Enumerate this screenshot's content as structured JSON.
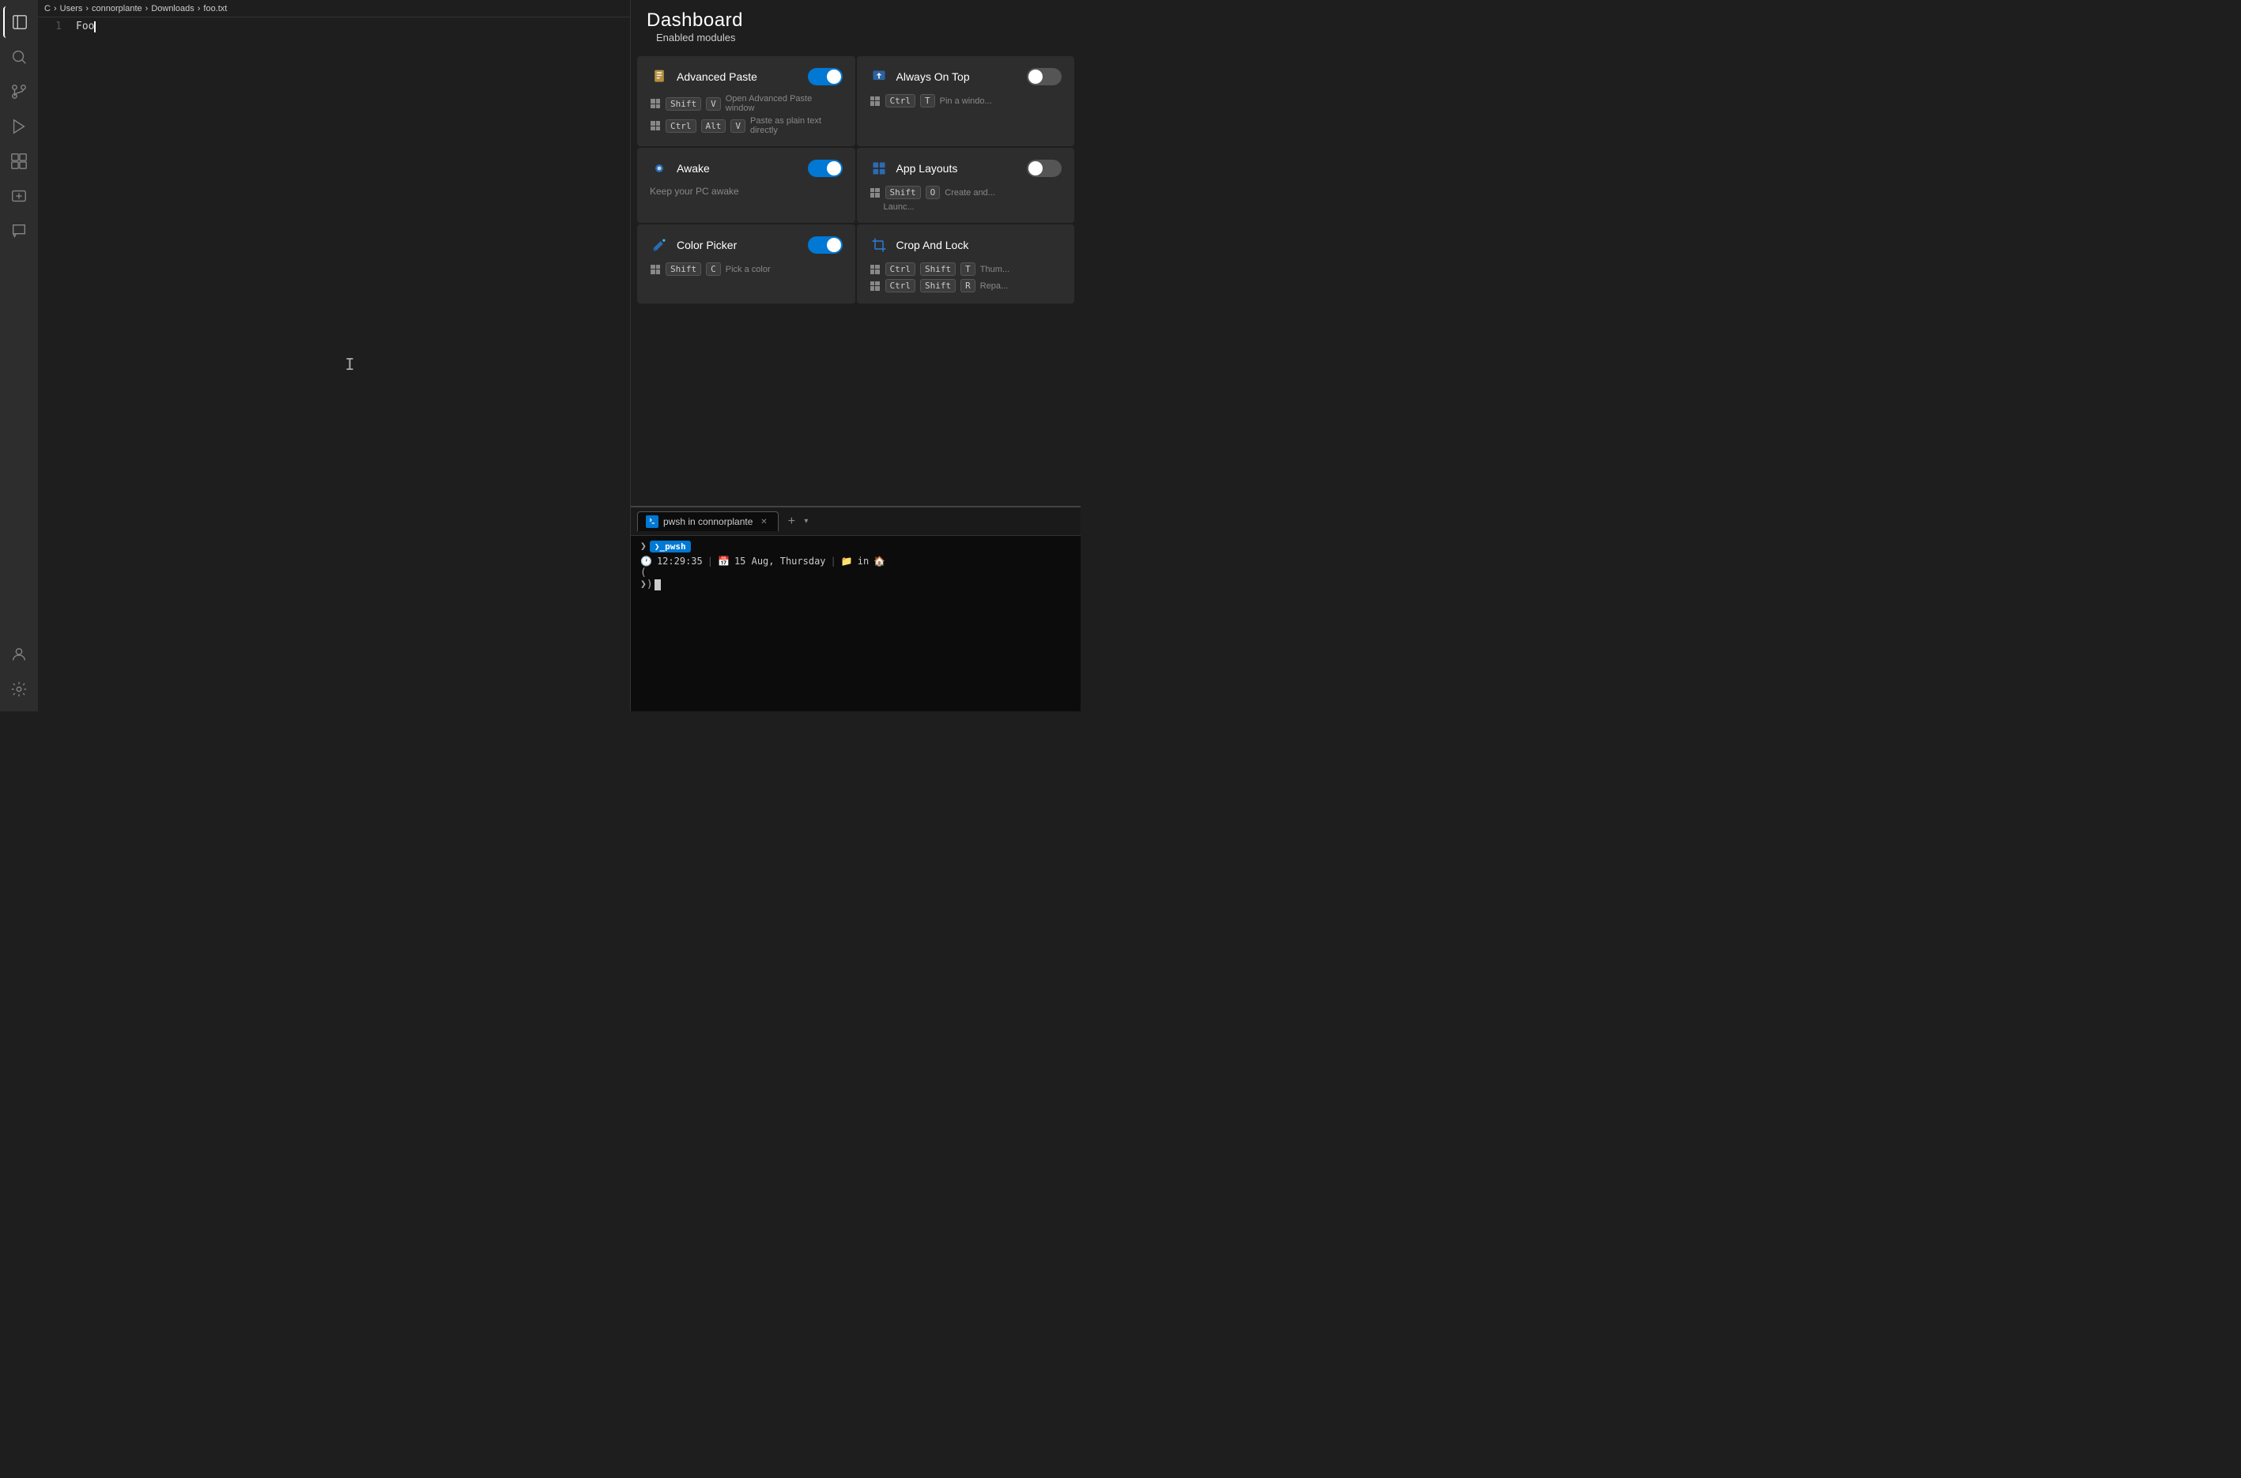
{
  "activityBar": {
    "icons": [
      {
        "name": "explorer-icon",
        "symbol": "☰",
        "active": true
      },
      {
        "name": "search-icon",
        "symbol": "🔍"
      },
      {
        "name": "source-control-icon",
        "symbol": "⑂"
      },
      {
        "name": "run-debug-icon",
        "symbol": "▶"
      },
      {
        "name": "extensions-icon",
        "symbol": "⊞"
      },
      {
        "name": "remote-icon",
        "symbol": "⬡"
      },
      {
        "name": "chat-icon",
        "symbol": "💬"
      }
    ],
    "bottomIcons": [
      {
        "name": "account-icon",
        "symbol": "👤"
      },
      {
        "name": "settings-icon",
        "symbol": "⚙"
      }
    ]
  },
  "editor": {
    "breadcrumb": "C > Users > connorplante > Downloads > foo.txt",
    "breadcrumbParts": [
      "C",
      "Users",
      "connorplante",
      "Downloads",
      "foo.txt"
    ],
    "lineNumber": "1",
    "lineContent": "Foo",
    "cursor": true
  },
  "dashboard": {
    "title": "Dashboard",
    "enabledLabel": "Enabled modules",
    "modules": [
      {
        "id": "advanced-paste",
        "name": "Advanced Paste",
        "icon": "📋",
        "iconBg": "#d4a843",
        "enabled": true,
        "shortcuts": [
          {
            "keys": [
              "Shift",
              "V"
            ],
            "desc": "Open Advanced Paste window"
          },
          {
            "keys": [
              "Ctrl",
              "Alt",
              "V"
            ],
            "desc": "Paste as plain text directly"
          }
        ]
      },
      {
        "id": "always-on-top",
        "name": "Always On Top",
        "icon": "📌",
        "iconBg": "#2b7ad4",
        "enabled": false,
        "shortcuts": [
          {
            "keys": [
              "Ctrl",
              "T"
            ],
            "desc": "Pin a windo..."
          }
        ]
      },
      {
        "id": "awake",
        "name": "Awake",
        "icon": "☕",
        "iconBg": "#2b7ad4",
        "enabled": true,
        "desc": "Keep your PC awake",
        "shortcuts": []
      },
      {
        "id": "app-layouts",
        "name": "App Layouts",
        "icon": "⊞",
        "iconBg": "#2b7ad4",
        "enabled": false,
        "shortcuts": [
          {
            "keys": [
              "Shift",
              "O"
            ],
            "desc": "Create and..."
          },
          {
            "keys": [],
            "desc": "Launc..."
          }
        ]
      },
      {
        "id": "color-picker",
        "name": "Color Picker",
        "icon": "✏️",
        "iconBg": "#2b7ad4",
        "enabled": true,
        "shortcuts": [
          {
            "keys": [
              "Shift",
              "C"
            ],
            "desc": "Pick a color"
          }
        ]
      },
      {
        "id": "crop-and-lock",
        "name": "Crop And Lock",
        "icon": "✂️",
        "iconBg": "#2b7ad4",
        "enabled": false,
        "shortcuts": [
          {
            "keys": [
              "Ctrl",
              "Shift",
              "T"
            ],
            "desc": "Thum..."
          },
          {
            "keys": [
              "Ctrl",
              "Shift",
              "R"
            ],
            "desc": "Repa..."
          }
        ]
      }
    ]
  },
  "terminal": {
    "tabLabel": "pwsh in connorplante",
    "closeBtn": "✕",
    "addBtn": "+",
    "dropdownBtn": "▾",
    "promptPrefix": "❯",
    "pwshBadge": "❯_pwsh",
    "clockIcon": "🕐",
    "timeText": "12:29:35",
    "separator": "|",
    "calIcon": "📅",
    "dateText": "15 Aug, Thursday",
    "folderIcon": "📁",
    "inText": "in",
    "homeIcon": "🏠",
    "promptSymbolLine1": "(",
    "promptSymbolLine2": "❯)"
  },
  "colors": {
    "toggleOn": "#0078d4",
    "toggleOff": "#555555",
    "terminalBg": "#0c0c0c",
    "cardBg": "#2d2d2d",
    "accent": "#0078d4"
  }
}
